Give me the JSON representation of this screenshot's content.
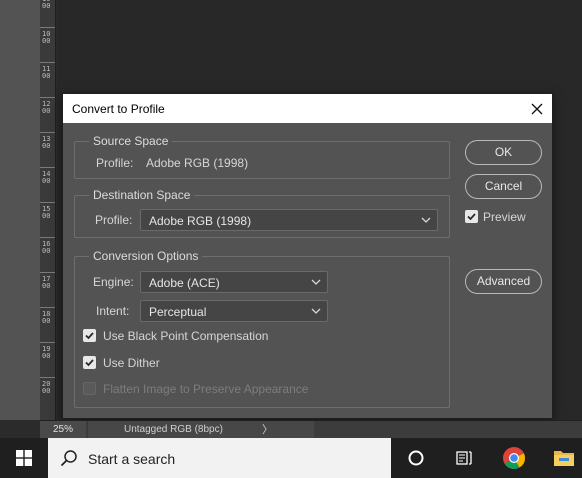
{
  "dialog": {
    "title": "Convert to Profile",
    "source": {
      "legend": "Source Space",
      "profile_label": "Profile:",
      "profile_value": "Adobe RGB (1998)"
    },
    "destination": {
      "legend": "Destination Space",
      "profile_label": "Profile:",
      "profile_selected": "Adobe RGB (1998)"
    },
    "conversion": {
      "legend": "Conversion Options",
      "engine_label": "Engine:",
      "engine_selected": "Adobe (ACE)",
      "intent_label": "Intent:",
      "intent_selected": "Perceptual",
      "black_point_label": "Use Black Point Compensation",
      "black_point_checked": true,
      "dither_label": "Use Dither",
      "dither_checked": true,
      "flatten_label": "Flatten Image to Preserve Appearance",
      "flatten_checked": false,
      "flatten_disabled": true
    },
    "buttons": {
      "ok": "OK",
      "cancel": "Cancel",
      "advanced": "Advanced"
    },
    "preview": {
      "label": "Preview",
      "checked": true
    }
  },
  "statusbar": {
    "zoom": "25%",
    "doc_info": "Untagged RGB (8bpc)",
    "chevron": "〉"
  },
  "ruler": {
    "labels": [
      "1000",
      "1000",
      "1100",
      "1200",
      "1300",
      "1400",
      "1500",
      "1600",
      "1700",
      "1800",
      "1900",
      "2000"
    ]
  },
  "taskbar": {
    "search_placeholder": "Start a search",
    "icons": [
      "windows-start-icon",
      "cortana-icon",
      "task-view-icon",
      "chrome-icon",
      "file-explorer-icon"
    ]
  },
  "colors": {
    "dialog_bg": "#535353",
    "workspace_bg": "#282828",
    "taskbar_bg": "#1f1f1f",
    "check_fill": "#e8e8e8"
  }
}
